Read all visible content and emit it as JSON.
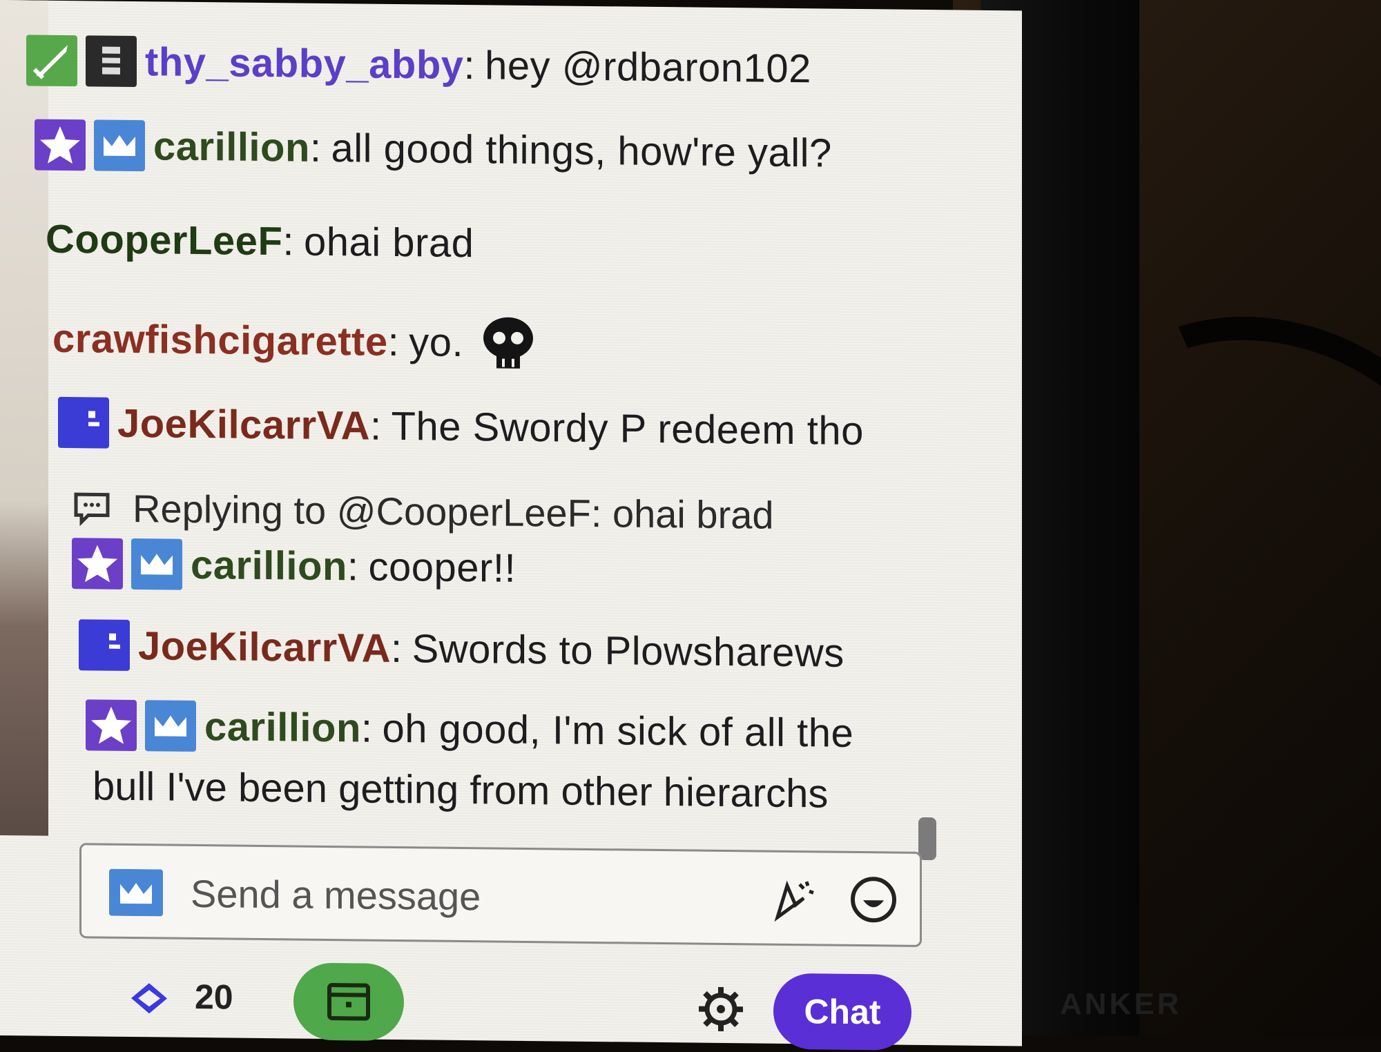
{
  "colors": {
    "accent": "#5b2fd6",
    "sub_badge_blue": "#4a86d6",
    "points_green": "#4fa84a",
    "user_thy": "#5b3fc8",
    "user_carillion": "#2f4a1f",
    "user_cooper": "#213a16",
    "user_crawfish": "#8b2f22",
    "user_joe": "#7a2a1c"
  },
  "messages": [
    {
      "user": "thy_sabby_abby",
      "sep": ":",
      "text": "hey @rdbaron102",
      "badges": [
        "sword-badge",
        "calendar-badge"
      ]
    },
    {
      "user": "carillion",
      "sep": ":",
      "text": "all good things, how're yall?",
      "badges": [
        "star-badge",
        "crown-badge"
      ]
    },
    {
      "user": "CooperLeeF",
      "sep": ":",
      "text": "ohai brad",
      "badges": []
    },
    {
      "user": "crawfishcigarette",
      "sep": ":",
      "text": "yo.",
      "badges": [],
      "emote": "skull-emote"
    },
    {
      "user": "JoeKilcarrVA",
      "sep": ":",
      "text": "The Swordy P redeem tho",
      "badges": [
        "face-badge"
      ]
    },
    {
      "reply_text": "Replying to @CooperLeeF: ohai brad"
    },
    {
      "user": "carillion",
      "sep": ":",
      "text": "cooper!!",
      "badges": [
        "star-badge",
        "crown-badge"
      ]
    },
    {
      "user": "JoeKilcarrVA",
      "sep": ":",
      "text": "Swords to Plowsharews",
      "badges": [
        "face-badge"
      ]
    },
    {
      "user": "carillion",
      "sep": ":",
      "text": "oh good, I'm sick of all the",
      "continuation": "bull I've been getting from other hierarchs",
      "badges": [
        "star-badge",
        "crown-badge"
      ]
    }
  ],
  "input": {
    "placeholder": "Send a message",
    "badge_icon": "crown-badge",
    "bits_icon": "bits-icon",
    "emoji_icon": "emoji-icon"
  },
  "footer": {
    "points": "20",
    "points_icon": "channel-points-icon",
    "reward_icon": "reward-icon",
    "settings_icon": "gear-icon",
    "chat_button": "Chat"
  },
  "monitor_brand": "ANKER"
}
